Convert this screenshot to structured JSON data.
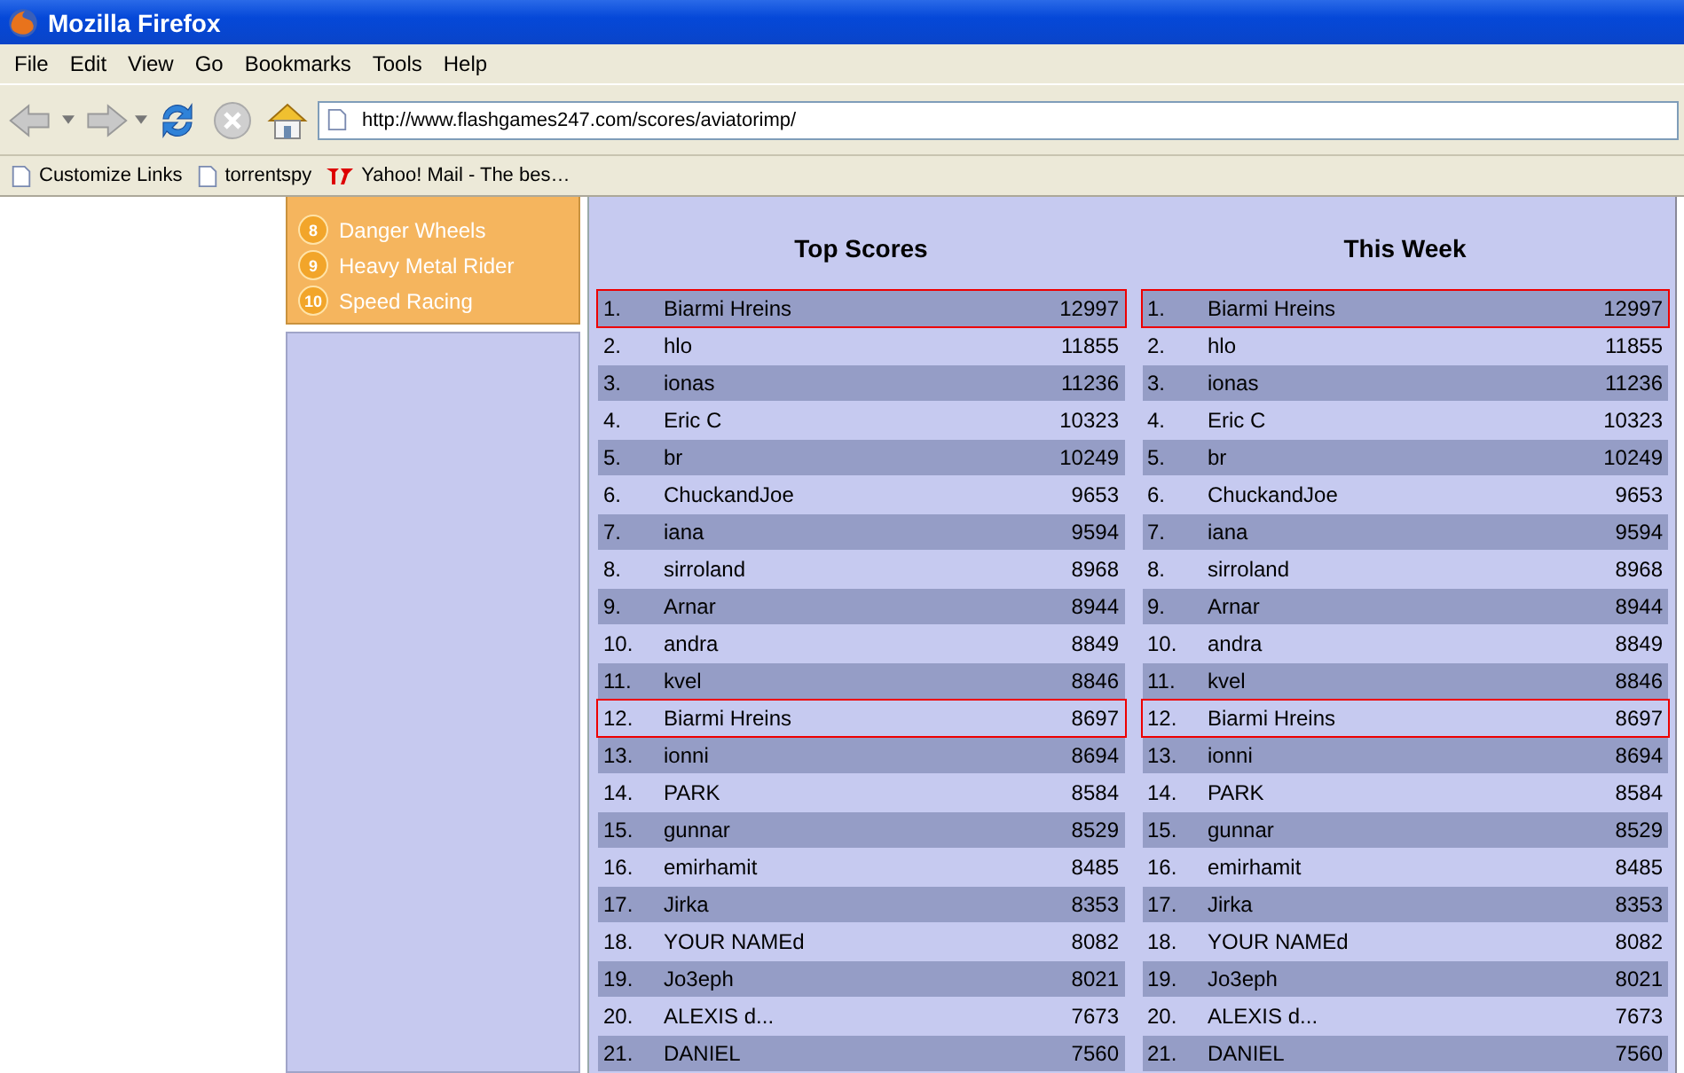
{
  "window": {
    "title": "Mozilla Firefox"
  },
  "menu": [
    "File",
    "Edit",
    "View",
    "Go",
    "Bookmarks",
    "Tools",
    "Help"
  ],
  "toolbar": {
    "back_disabled": true,
    "forward_disabled": true,
    "stop_disabled": true,
    "url": "http://www.flashgames247.com/scores/aviatorimp/"
  },
  "bookmarks": [
    {
      "label": "Customize Links",
      "kind": "page"
    },
    {
      "label": "torrentspy",
      "kind": "page"
    },
    {
      "label": "Yahoo! Mail - The bes…",
      "kind": "yahoo"
    }
  ],
  "sidebar": {
    "games": [
      {
        "number": "8",
        "name": "Danger Wheels"
      },
      {
        "number": "9",
        "name": "Heavy Metal Rider"
      },
      {
        "number": "10",
        "name": "Speed Racing"
      }
    ]
  },
  "tables": [
    {
      "title": "Top Scores",
      "rows": [
        {
          "rank": "1.",
          "name": "Biarmi Hreins",
          "score": "12997",
          "circled": true
        },
        {
          "rank": "2.",
          "name": "hlo",
          "score": "11855",
          "circled": false
        },
        {
          "rank": "3.",
          "name": "ionas",
          "score": "11236",
          "circled": false
        },
        {
          "rank": "4.",
          "name": "Eric C",
          "score": "10323",
          "circled": false
        },
        {
          "rank": "5.",
          "name": "br",
          "score": "10249",
          "circled": false
        },
        {
          "rank": "6.",
          "name": "ChuckandJoe",
          "score": "9653",
          "circled": false
        },
        {
          "rank": "7.",
          "name": "iana",
          "score": "9594",
          "circled": false
        },
        {
          "rank": "8.",
          "name": "sirroland",
          "score": "8968",
          "circled": false
        },
        {
          "rank": "9.",
          "name": "Arnar",
          "score": "8944",
          "circled": false
        },
        {
          "rank": "10.",
          "name": "andra",
          "score": "8849",
          "circled": false
        },
        {
          "rank": "11.",
          "name": "kvel",
          "score": "8846",
          "circled": false
        },
        {
          "rank": "12.",
          "name": "Biarmi Hreins",
          "score": "8697",
          "circled": true
        },
        {
          "rank": "13.",
          "name": "ionni",
          "score": "8694",
          "circled": false
        },
        {
          "rank": "14.",
          "name": "PARK",
          "score": "8584",
          "circled": false
        },
        {
          "rank": "15.",
          "name": "gunnar",
          "score": "8529",
          "circled": false
        },
        {
          "rank": "16.",
          "name": "emirhamit",
          "score": "8485",
          "circled": false
        },
        {
          "rank": "17.",
          "name": "Jirka",
          "score": "8353",
          "circled": false
        },
        {
          "rank": "18.",
          "name": "YOUR NAMEd",
          "score": "8082",
          "circled": false
        },
        {
          "rank": "19.",
          "name": "Jo3eph",
          "score": "8021",
          "circled": false
        },
        {
          "rank": "20.",
          "name": "ALEXIS d...",
          "score": "7673",
          "circled": false
        },
        {
          "rank": "21.",
          "name": "DANIEL",
          "score": "7560",
          "circled": false
        }
      ]
    },
    {
      "title": "This Week",
      "rows": [
        {
          "rank": "1.",
          "name": "Biarmi Hreins",
          "score": "12997",
          "circled": true
        },
        {
          "rank": "2.",
          "name": "hlo",
          "score": "11855",
          "circled": false
        },
        {
          "rank": "3.",
          "name": "ionas",
          "score": "11236",
          "circled": false
        },
        {
          "rank": "4.",
          "name": "Eric C",
          "score": "10323",
          "circled": false
        },
        {
          "rank": "5.",
          "name": "br",
          "score": "10249",
          "circled": false
        },
        {
          "rank": "6.",
          "name": "ChuckandJoe",
          "score": "9653",
          "circled": false
        },
        {
          "rank": "7.",
          "name": "iana",
          "score": "9594",
          "circled": false
        },
        {
          "rank": "8.",
          "name": "sirroland",
          "score": "8968",
          "circled": false
        },
        {
          "rank": "9.",
          "name": "Arnar",
          "score": "8944",
          "circled": false
        },
        {
          "rank": "10.",
          "name": "andra",
          "score": "8849",
          "circled": false
        },
        {
          "rank": "11.",
          "name": "kvel",
          "score": "8846",
          "circled": false
        },
        {
          "rank": "12.",
          "name": "Biarmi Hreins",
          "score": "8697",
          "circled": true
        },
        {
          "rank": "13.",
          "name": "ionni",
          "score": "8694",
          "circled": false
        },
        {
          "rank": "14.",
          "name": "PARK",
          "score": "8584",
          "circled": false
        },
        {
          "rank": "15.",
          "name": "gunnar",
          "score": "8529",
          "circled": false
        },
        {
          "rank": "16.",
          "name": "emirhamit",
          "score": "8485",
          "circled": false
        },
        {
          "rank": "17.",
          "name": "Jirka",
          "score": "8353",
          "circled": false
        },
        {
          "rank": "18.",
          "name": "YOUR NAMEd",
          "score": "8082",
          "circled": false
        },
        {
          "rank": "19.",
          "name": "Jo3eph",
          "score": "8021",
          "circled": false
        },
        {
          "rank": "20.",
          "name": "ALEXIS d...",
          "score": "7673",
          "circled": false
        },
        {
          "rank": "21.",
          "name": "DANIEL",
          "score": "7560",
          "circled": false
        }
      ]
    }
  ]
}
